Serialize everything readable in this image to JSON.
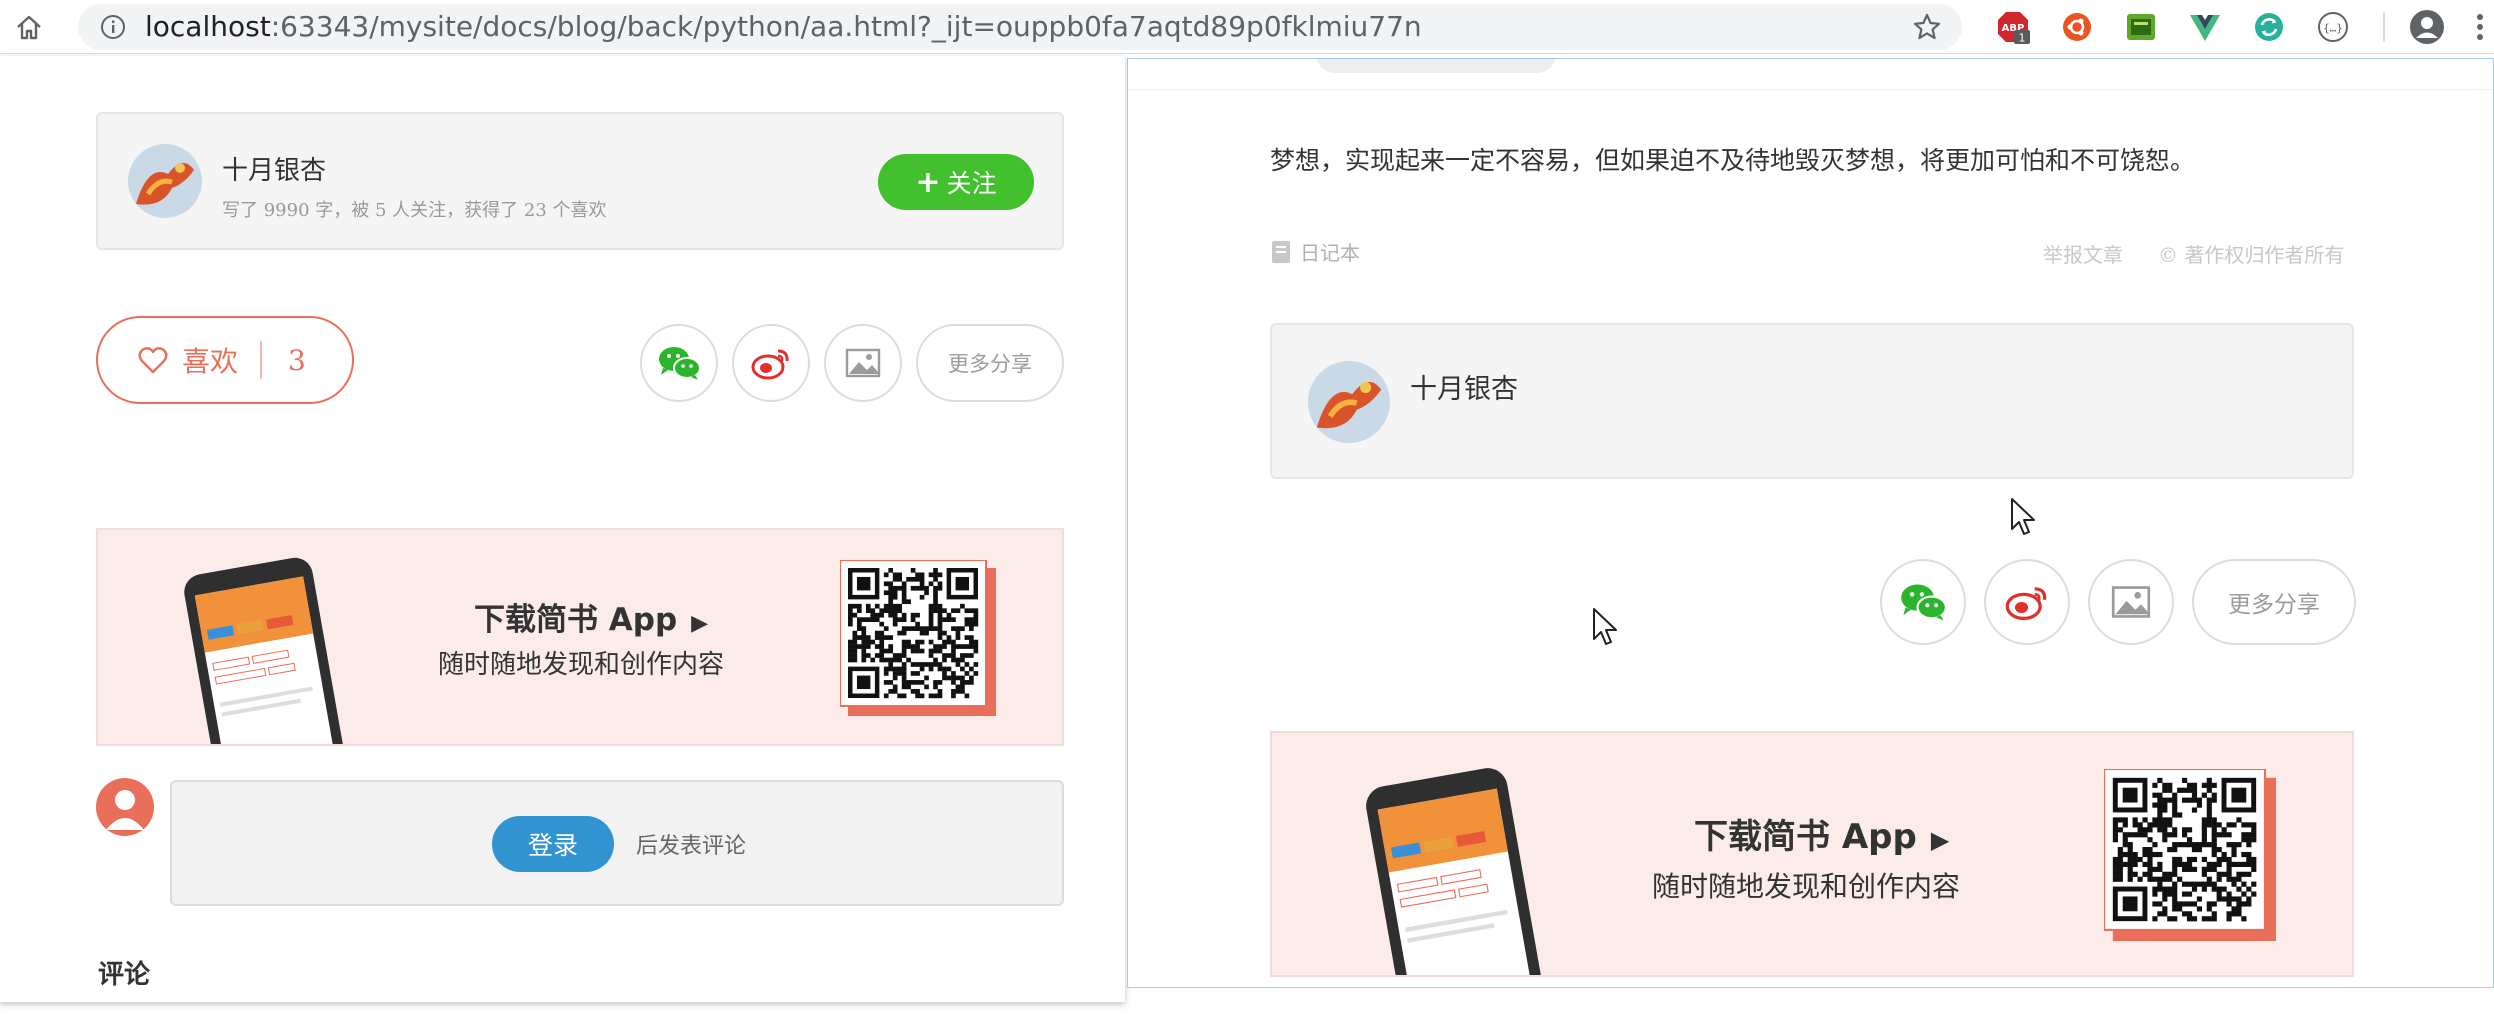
{
  "browser": {
    "url_host": "localhost",
    "url_rest": ":63343/mysite/docs/blog/back/python/aa.html?_ijt=ouppb0fa7aqtd89p0fklmiu77n",
    "abp_badge": "ABP",
    "abp_count": "1",
    "extensions": [
      "abp-icon",
      "ubuntu-icon",
      "green-extension-icon",
      "vue-devtools-icon",
      "sync-icon",
      "json-viewer-icon"
    ]
  },
  "left": {
    "author": {
      "name": "十月银杏",
      "meta": "写了 9990 字，被 5 人关注，获得了 23 个喜欢",
      "follow_label": "关注",
      "follow_plus": "+"
    },
    "like": {
      "label": "喜欢",
      "count": "3"
    },
    "share_more": "更多分享",
    "banner": {
      "title": "下载简书 App",
      "subtitle": "随时随地发现和创作内容"
    },
    "comment": {
      "login": "登录",
      "after_login": "后发表评论"
    },
    "comments_heading": "评论"
  },
  "right": {
    "quote": "梦想，实现起来一定不容易，但如果迫不及待地毁灭梦想，将更加可怕和不可饶恕。",
    "notebook": "日记本",
    "report": "举报文章",
    "copyright_symbol": "©",
    "copyright": "著作权归作者所有",
    "author_name": "十月银杏",
    "share_more": "更多分享",
    "banner": {
      "title": "下载简书 App",
      "subtitle": "随时随地发现和创作内容"
    }
  },
  "colors": {
    "follow_green": "#42c02e",
    "like_red": "#ea6f5a",
    "login_blue": "#3194d0",
    "banner_bg": "#fbecea",
    "wechat_green": "#2ab52c",
    "weibo_red": "#e0302b"
  }
}
